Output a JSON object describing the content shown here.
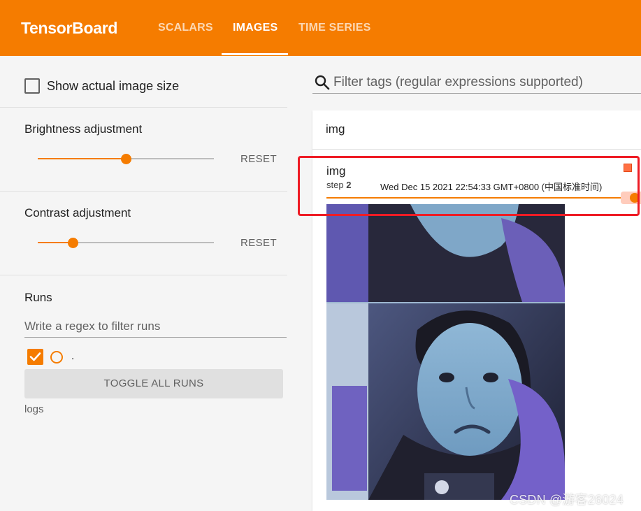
{
  "header": {
    "brand": "TensorBoard",
    "tabs": [
      {
        "label": "SCALARS",
        "active": false
      },
      {
        "label": "IMAGES",
        "active": true
      },
      {
        "label": "TIME SERIES",
        "active": false
      }
    ]
  },
  "sidebar": {
    "show_actual_size_label": "Show actual image size",
    "show_actual_size_checked": false,
    "brightness": {
      "label": "Brightness adjustment",
      "reset": "RESET",
      "value_fraction": 0.5
    },
    "contrast": {
      "label": "Contrast adjustment",
      "reset": "RESET",
      "value_fraction": 0.2
    },
    "runs": {
      "title": "Runs",
      "filter_placeholder": "Write a regex to filter runs",
      "run_name": ".",
      "run_checked": true,
      "toggle_label": "TOGGLE ALL RUNS",
      "logdir": "logs"
    }
  },
  "main": {
    "filter_placeholder": "Filter tags (regular expressions supported)",
    "card": {
      "tag": "img",
      "image_title": "img",
      "step_label": "step",
      "step_value": "2",
      "timestamp": "Wed Dec 15 2021 22:54:33 GMT+0800 (中国标准时间)",
      "step_fraction": 1.0
    }
  },
  "watermark": "CSDN @游客26024",
  "colors": {
    "accent": "#f57c00",
    "highlight_box": "#ee1c25"
  }
}
